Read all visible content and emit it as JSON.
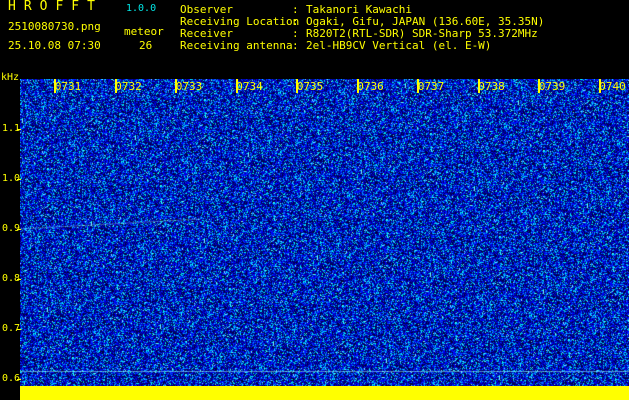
{
  "header": {
    "app_name": "HROFFT",
    "version": "1.0.0",
    "filename": "2510080730.png",
    "datetime": "25.10.08 07:30",
    "meteor_label": "meteor",
    "meteor_count": "26"
  },
  "info": [
    {
      "label": "Observer",
      "value": "Takanori Kawachi"
    },
    {
      "label": "Receiving Location",
      "value": "Ogaki, Gifu, JAPAN (136.60E, 35.35N)"
    },
    {
      "label": "Receiver",
      "value": "R820T2(RTL-SDR) SDR-Sharp 53.372MHz"
    },
    {
      "label": "Receiving antenna",
      "value": "2el-HB9CV Vertical (el. E-W)"
    }
  ],
  "info_separator": ":",
  "time_axis": {
    "ticks": [
      "0731",
      "0732",
      "0733",
      "0734",
      "0735",
      "0736",
      "0737",
      "0738",
      "0739",
      "0740"
    ]
  },
  "freq_axis": {
    "unit": "kHz",
    "ticks": [
      "1.1",
      "1.0",
      "0.9",
      "0.8",
      "0.7",
      "0.6"
    ]
  },
  "colors": {
    "text": "#ffff00",
    "accent": "#00e6e6",
    "background": "#000000",
    "noise_dark": "#000080",
    "noise_mid": "#0000ff",
    "noise_light": "#00ffff"
  }
}
